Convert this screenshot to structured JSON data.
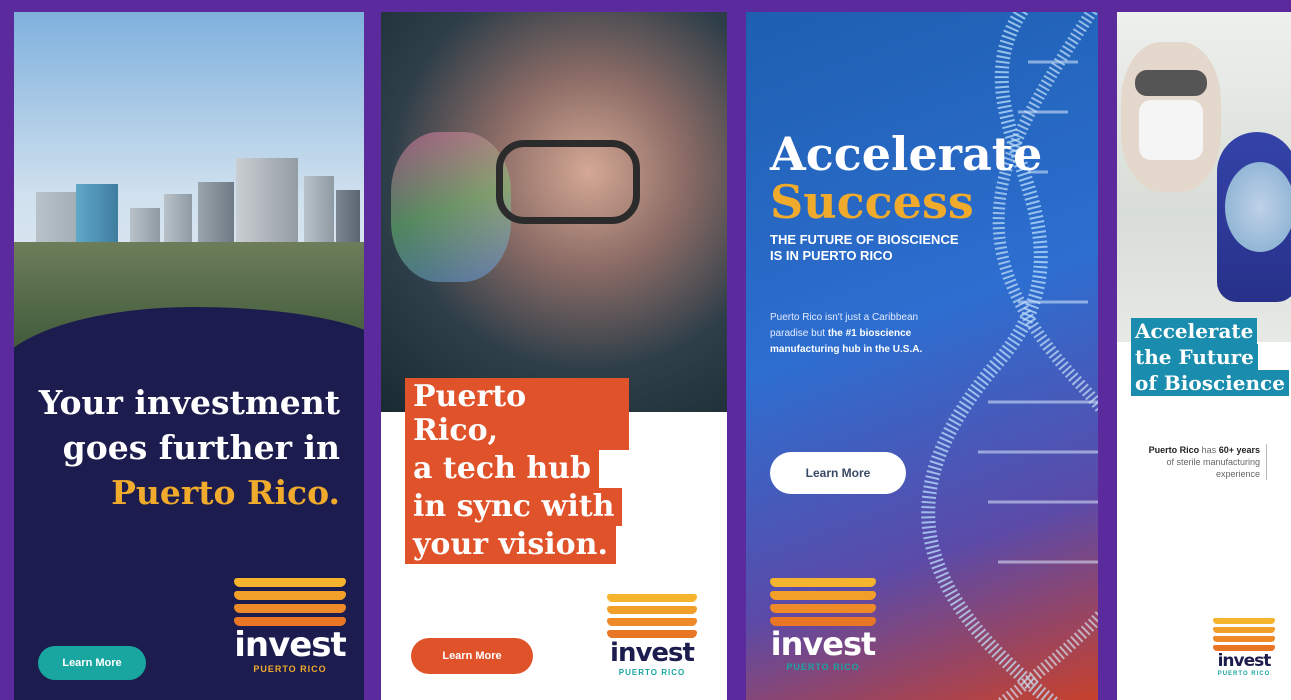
{
  "ad1": {
    "headline_line1": "Your investment",
    "headline_line2": "goes further in",
    "headline_highlight": "Puerto Rico.",
    "button": "Learn More",
    "logo_word": "invest",
    "logo_sub": "PUERTO RICO"
  },
  "ad2": {
    "headline_lines": [
      "Puerto Rico,",
      "a tech hub",
      "in sync with",
      "your vision."
    ],
    "button": "Learn More",
    "logo_word": "invest",
    "logo_sub": "PUERTO RICO"
  },
  "ad3": {
    "title_line1": "Accelerate",
    "title_line2": "Success",
    "subtitle_line1": "THE FUTURE OF BIOSCIENCE",
    "subtitle_line2": "IS IN PUERTO RICO",
    "body_plain": "Puerto Rico isn't just a Caribbean paradise but",
    "body_bold": "the #1 bioscience manufacturing hub in the U.S.A.",
    "button": "Learn More",
    "logo_word": "invest",
    "logo_sub": "PUERTO RICO"
  },
  "ad4": {
    "title_lines": [
      "Accelerate",
      "the Future",
      "of Bioscience"
    ],
    "body_bold1": "Puerto Rico",
    "body_plain1": "has",
    "body_bold2": "60+ years",
    "body_plain2": "of sterile manufacturing experience",
    "logo_word": "invest",
    "logo_sub": "PUERTO RICO"
  },
  "colors": {
    "background": "#5b2a9c",
    "navy": "#1c1c4e",
    "gold": "#f0ab2d",
    "orange_red": "#e0522a",
    "teal": "#1aa6a0",
    "blue_box": "#1a8cad"
  }
}
